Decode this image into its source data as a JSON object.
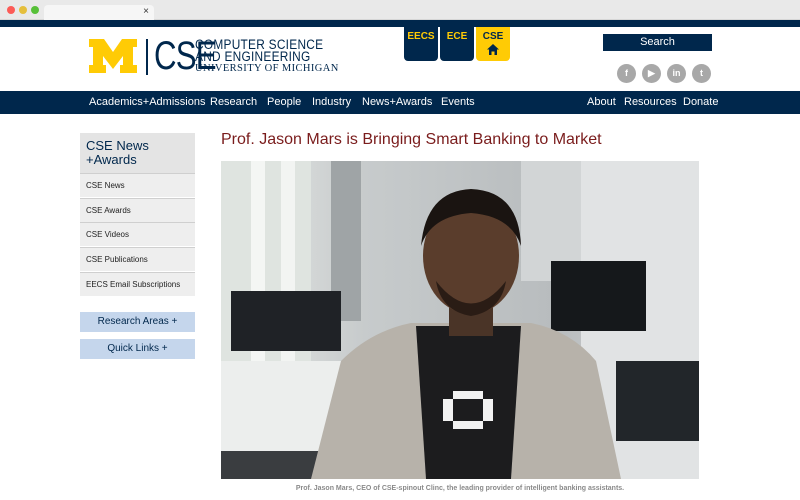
{
  "browser": {
    "tab_close": "×"
  },
  "header": {
    "logo_cse": "CSE",
    "logo_line1": "COMPUTER SCIENCE",
    "logo_line2": "AND ENGINEERING",
    "logo_line3": "UNIVERSITY OF MICHIGAN",
    "dept_tabs": [
      "EECS",
      "ECE",
      "CSE"
    ],
    "search_label": "Search",
    "social": [
      {
        "icon": "facebook-icon",
        "glyph": "f"
      },
      {
        "icon": "youtube-icon",
        "glyph": "▶"
      },
      {
        "icon": "linkedin-icon",
        "glyph": "in"
      },
      {
        "icon": "twitter-icon",
        "glyph": "t"
      }
    ]
  },
  "nav": {
    "left": [
      "Academics+Admissions",
      "Research",
      "People",
      "Industry",
      "News+Awards",
      "Events"
    ],
    "right": [
      "About",
      "Resources",
      "Donate"
    ]
  },
  "sidebar": {
    "title": "CSE News +Awards",
    "items": [
      "CSE News",
      "CSE Awards",
      "CSE Videos",
      "CSE Publications",
      "EECS Email Subscriptions"
    ],
    "buttons": [
      "Research Areas +",
      "Quick Links +"
    ]
  },
  "article": {
    "title": "Prof. Jason Mars is Bringing Smart Banking to Market",
    "caption": "Prof. Jason Mars, CEO of CSE-spinout Clinc, the leading provider of intelligent banking assistants."
  },
  "colors": {
    "navy": "#00274c",
    "maize": "#ffcb05",
    "title_red": "#7a1c1c",
    "sidebar_btn": "#c5d6ec"
  }
}
